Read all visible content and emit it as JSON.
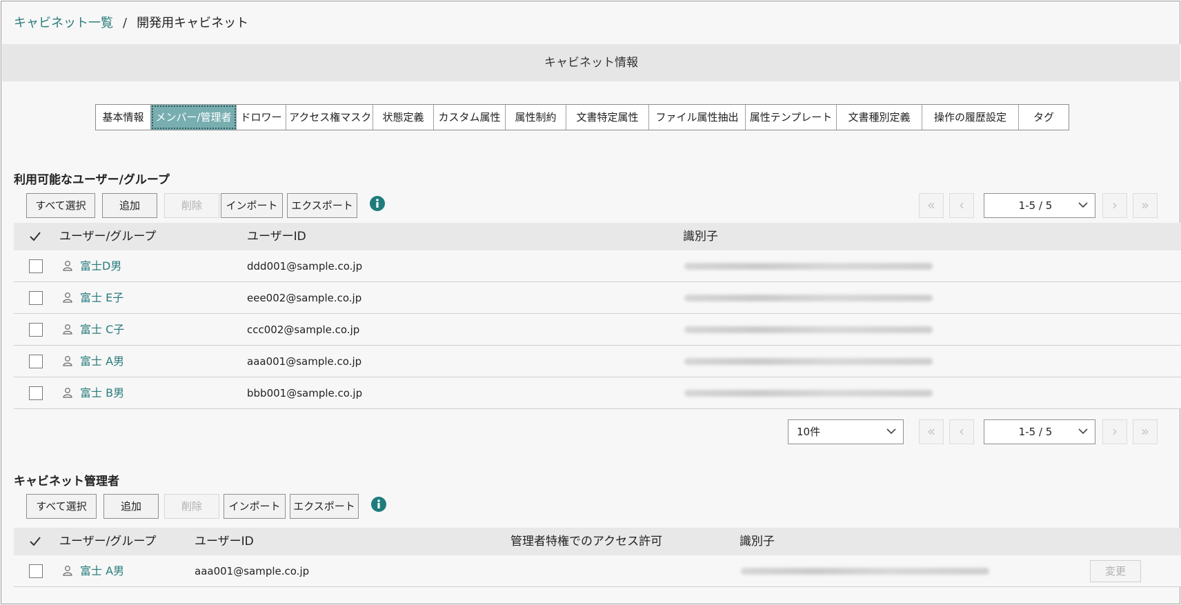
{
  "breadcrumb": {
    "parent": "キャビネット一覧",
    "separator": "/",
    "current": "開発用キャビネット"
  },
  "title": "キャビネット情報",
  "tabs": [
    {
      "label": "基本情報"
    },
    {
      "label": "メンバー/管理者",
      "active": true
    },
    {
      "label": "ドロワー"
    },
    {
      "label": "アクセス権マスク"
    },
    {
      "label": "状態定義"
    },
    {
      "label": "カスタム属性"
    },
    {
      "label": "属性制約"
    },
    {
      "label": "文書特定属性"
    },
    {
      "label": "ファイル属性抽出"
    },
    {
      "label": "属性テンプレート"
    },
    {
      "label": "文書種別定義"
    },
    {
      "label": "操作の履歴設定"
    },
    {
      "label": "タグ"
    }
  ],
  "available": {
    "title": "利用可能なユーザー/グループ",
    "buttons": {
      "select_all": "すべて選択",
      "add": "追加",
      "delete": "削除",
      "import": "インポート",
      "export": "エクスポート"
    },
    "pager_top": {
      "range": "1-5 / 5"
    },
    "columns": {
      "user_group": "ユーザー/グループ",
      "user_id": "ユーザーID",
      "identifier": "識別子"
    },
    "rows": [
      {
        "name": "富士D男",
        "user_id": "ddd001@sample.co.jp"
      },
      {
        "name": "富士 E子",
        "user_id": "eee002@sample.co.jp"
      },
      {
        "name": "富士 C子",
        "user_id": "ccc002@sample.co.jp"
      },
      {
        "name": "富士 A男",
        "user_id": "aaa001@sample.co.jp"
      },
      {
        "name": "富士 B男",
        "user_id": "bbb001@sample.co.jp"
      }
    ],
    "page_size": "10件",
    "pager_bottom": {
      "range": "1-5 / 5"
    }
  },
  "managers": {
    "title": "キャビネット管理者",
    "buttons": {
      "select_all": "すべて選択",
      "add": "追加",
      "delete": "削除",
      "import": "インポート",
      "export": "エクスポート"
    },
    "columns": {
      "user_group": "ユーザー/グループ",
      "user_id": "ユーザーID",
      "privilege": "管理者特権でのアクセス許可",
      "identifier": "識別子"
    },
    "rows": [
      {
        "name": "富士 A男",
        "user_id": "aaa001@sample.co.jp",
        "change": "変更"
      }
    ]
  },
  "icons": {
    "info": "info-icon",
    "person": "person-icon",
    "check": "checkmark-icon",
    "chevron": "chevron-down-icon"
  },
  "colors": {
    "accent": "#2a7b7b",
    "active_tab": "#79aeb1"
  }
}
